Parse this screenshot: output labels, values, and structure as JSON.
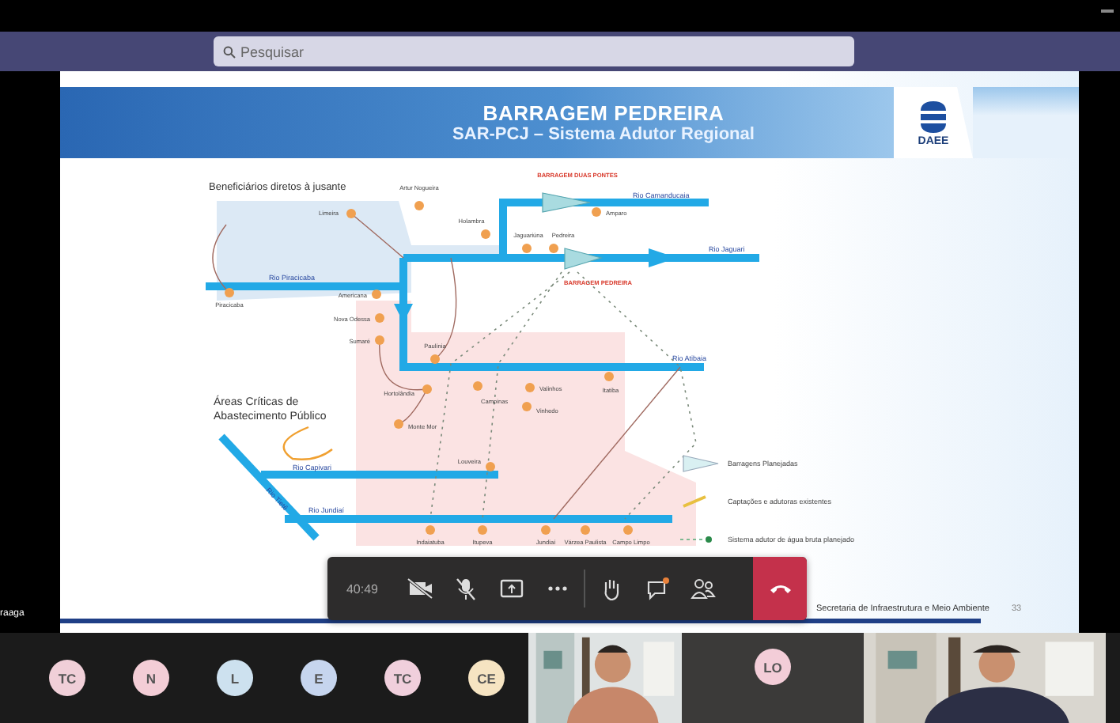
{
  "window": {
    "search": {
      "placeholder": "Pesquisar"
    }
  },
  "slide": {
    "title": "BARRAGEM PEDREIRA",
    "subtitle": "SAR-PCJ – Sistema Adutor Regional",
    "logo_text": "DAEE",
    "map": {
      "heading": "Beneficiários diretos à jusante",
      "areas_label": "Áreas Críticas de Abastecimento Público",
      "rivers": [
        {
          "name": "Rio Piracicaba"
        },
        {
          "name": "Rio Jaguari"
        },
        {
          "name": "Rio Camanducaia"
        },
        {
          "name": "Rio Atibaia"
        },
        {
          "name": "Rio Capivari"
        },
        {
          "name": "Rio Jundiaí"
        },
        {
          "name": "Rio Tietê"
        }
      ],
      "dams": [
        {
          "name": "BARRAGEM DUAS PONTES"
        },
        {
          "name": "BARRAGEM PEDREIRA"
        }
      ],
      "towns": [
        {
          "name": "Limeira"
        },
        {
          "name": "Artur Nogueira"
        },
        {
          "name": "Holambra"
        },
        {
          "name": "Jaguariúna"
        },
        {
          "name": "Pedreira"
        },
        {
          "name": "Amparo"
        },
        {
          "name": "Piracicaba"
        },
        {
          "name": "Americana"
        },
        {
          "name": "Nova Odessa"
        },
        {
          "name": "Sumaré"
        },
        {
          "name": "Paulínia"
        },
        {
          "name": "Hortolândia"
        },
        {
          "name": "Campinas"
        },
        {
          "name": "Valinhos"
        },
        {
          "name": "Vinhedo"
        },
        {
          "name": "Itatiba"
        },
        {
          "name": "Monte Mor"
        },
        {
          "name": "Louveira"
        },
        {
          "name": "Indaiatuba"
        },
        {
          "name": "Itupeva"
        },
        {
          "name": "Jundiaí"
        },
        {
          "name": "Várzea Paulista"
        },
        {
          "name": "Campo Limpo"
        }
      ],
      "legend": [
        {
          "kind": "dam",
          "label": "Barragens Planejadas"
        },
        {
          "kind": "existing",
          "label": "Captações e adutoras existentes"
        },
        {
          "kind": "planned",
          "label": "Sistema adutor de água bruta planejado"
        }
      ]
    },
    "footer": "Secretaria de Infraestrutura e Meio Ambiente",
    "page_number": "33"
  },
  "presenter_label": "raaga",
  "toolbar": {
    "timer": "40:49",
    "buttons": [
      {
        "kind": "camera-off"
      },
      {
        "kind": "mic-off"
      },
      {
        "kind": "share"
      },
      {
        "kind": "more"
      },
      {
        "kind": "hand"
      },
      {
        "kind": "chat"
      },
      {
        "kind": "people"
      },
      {
        "kind": "hangup"
      }
    ]
  },
  "participants": [
    {
      "kind": "avatar",
      "initials": "TC",
      "color": "#f0cfd8"
    },
    {
      "kind": "avatar",
      "initials": "N",
      "color": "#f3cdd6"
    },
    {
      "kind": "avatar",
      "initials": "L",
      "color": "#cde1ef"
    },
    {
      "kind": "avatar",
      "initials": "E",
      "color": "#c6d5ee"
    },
    {
      "kind": "avatar",
      "initials": "TC",
      "color": "#f0cfdc"
    },
    {
      "kind": "avatar",
      "initials": "CE",
      "color": "#f6e4c2"
    },
    {
      "kind": "video"
    },
    {
      "kind": "avatar-tile",
      "initials": "LO",
      "color": "#f3cdd8"
    },
    {
      "kind": "video"
    }
  ]
}
